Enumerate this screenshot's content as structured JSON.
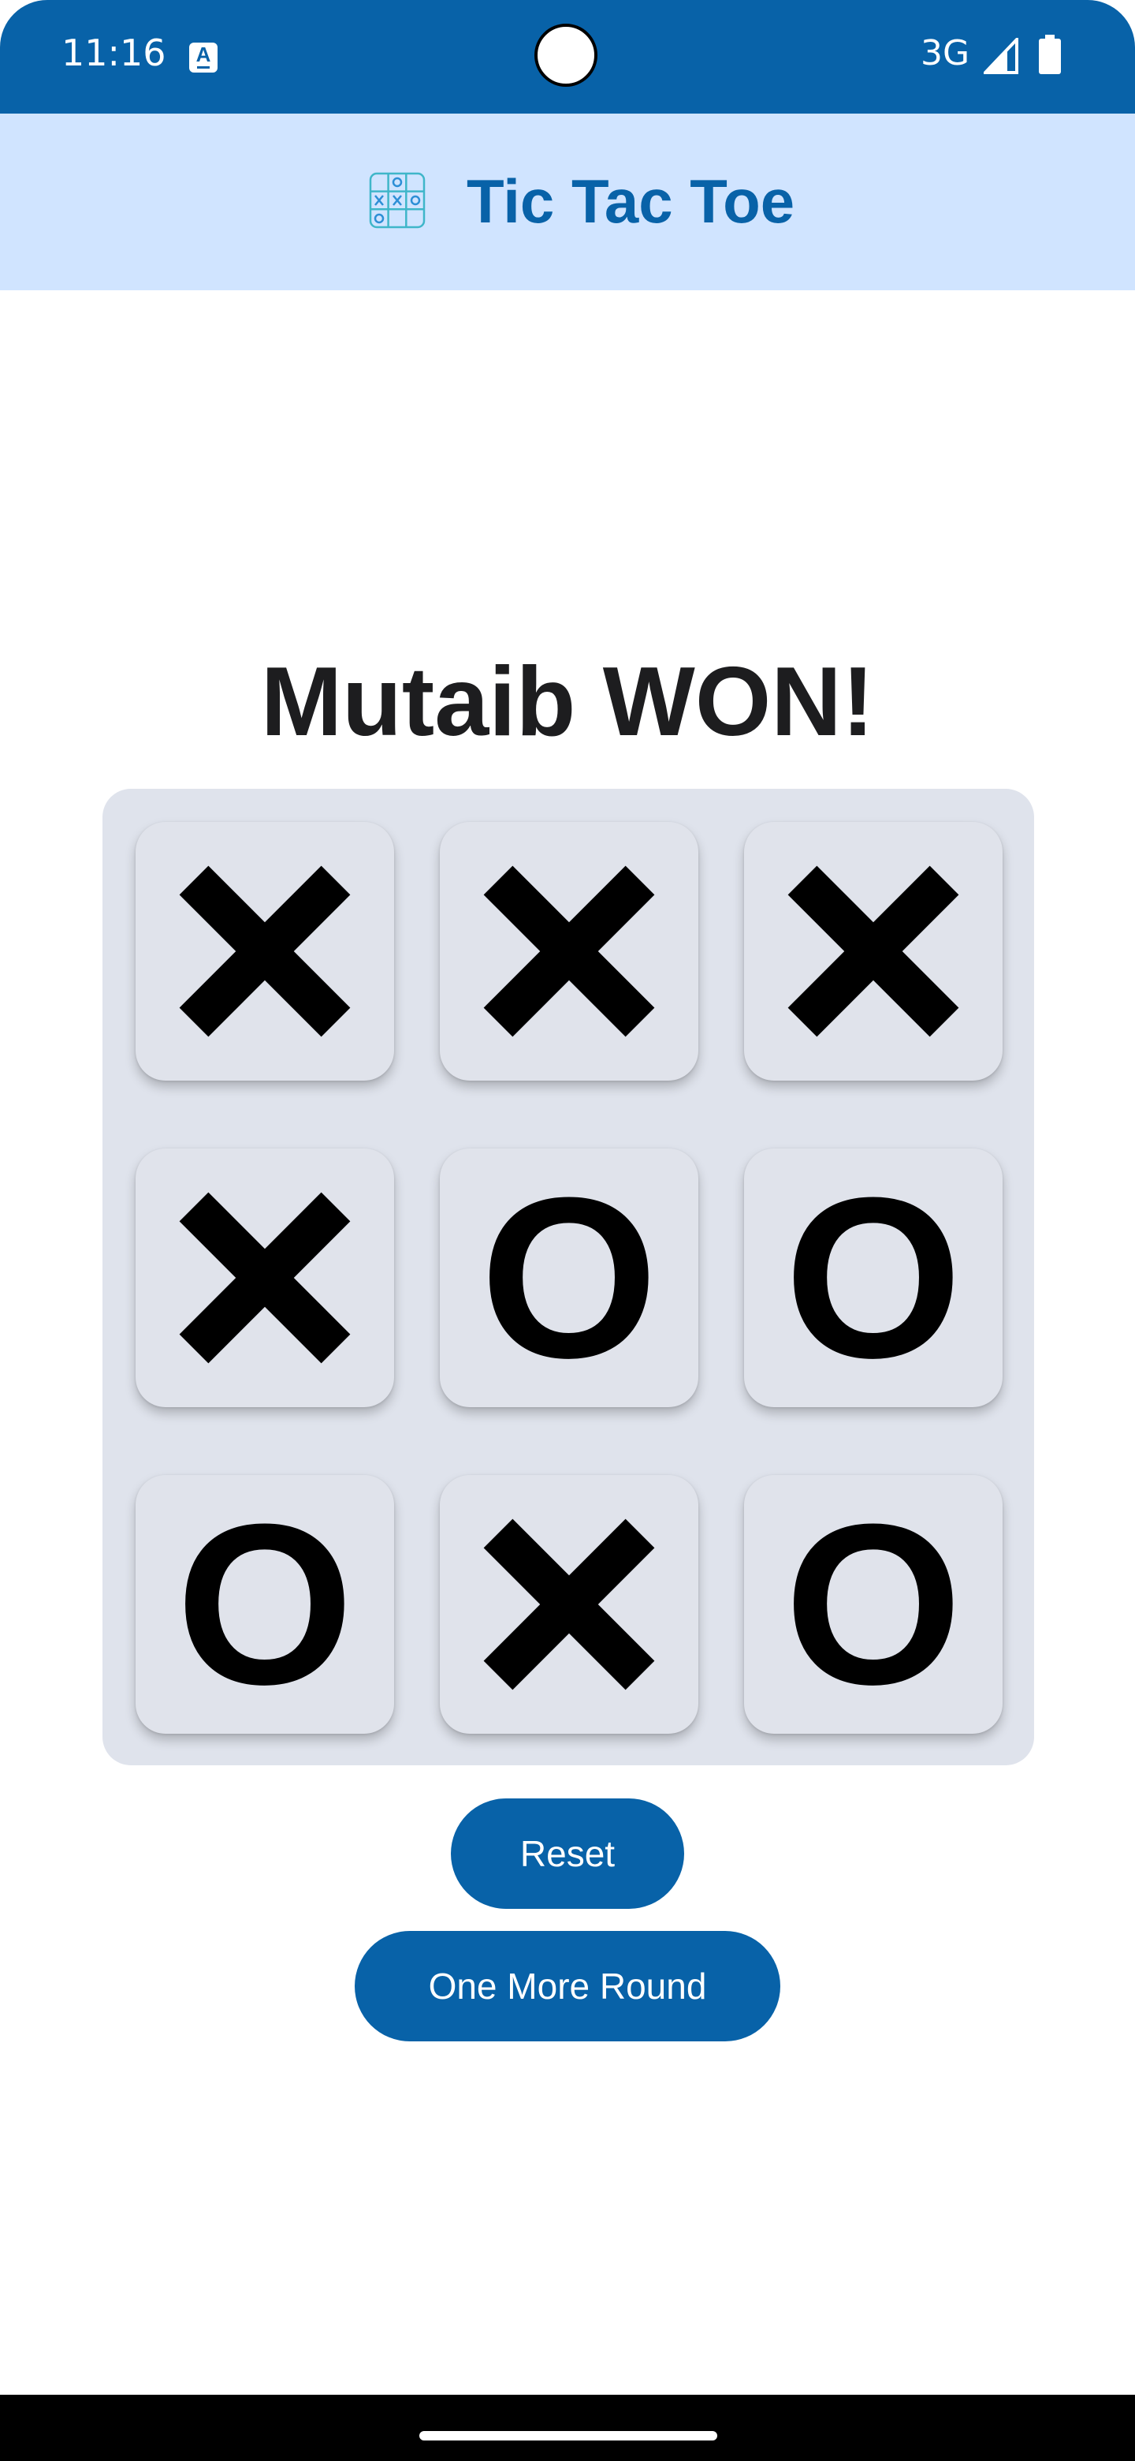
{
  "status_bar": {
    "time": "11:16",
    "network": "3G",
    "notification_icon": "a-icon",
    "signal_icon": "signal-icon",
    "battery_icon": "battery-icon"
  },
  "app_bar": {
    "title": "Tic Tac Toe",
    "icon": "tic-tac-toe-icon"
  },
  "game": {
    "result": "Mutaib WON!",
    "board": [
      [
        "X",
        "X",
        "X"
      ],
      [
        "X",
        "O",
        "O"
      ],
      [
        "O",
        "X",
        "O"
      ]
    ]
  },
  "buttons": {
    "reset": "Reset",
    "one_more_round": "One More Round"
  },
  "colors": {
    "primary": "#0862a8",
    "app_bar_bg": "#d0e4ff",
    "board_bg": "#dfe3ec"
  }
}
